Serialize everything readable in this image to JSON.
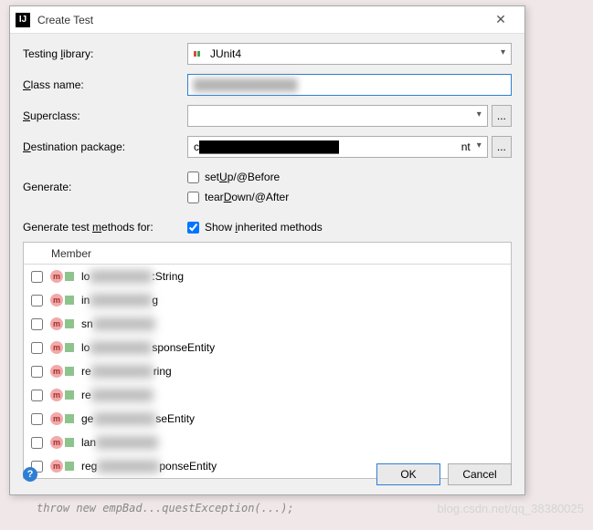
{
  "dialog": {
    "title": "Create Test",
    "labels": {
      "testing_library": "Testing library:",
      "class_name": "Class name:",
      "superclass": "Superclass:",
      "destination": "Destination package:",
      "generate": "Generate:",
      "methods_for": "Generate test methods for:"
    },
    "testing_library_value": "JUnit4",
    "class_name_value": "",
    "superclass_value": "",
    "destination_prefix": "c",
    "destination_suffix": "nt",
    "setup_label": "setUp/@Before",
    "teardown_label": "tearDown/@After",
    "show_inherited_label": "Show inherited methods",
    "show_inherited_checked": true,
    "member_header": "Member",
    "methods": [
      {
        "prefix": "lo",
        "suffix": ":String"
      },
      {
        "prefix": "in",
        "suffix": "g"
      },
      {
        "prefix": "sn",
        "suffix": ""
      },
      {
        "prefix": "lo",
        "suffix": "sponseEntity"
      },
      {
        "prefix": "re",
        "suffix": "ring"
      },
      {
        "prefix": "re",
        "suffix": ""
      },
      {
        "prefix": "ge",
        "suffix": "seEntity"
      },
      {
        "prefix": "lan",
        "suffix": ""
      },
      {
        "prefix": "reg",
        "suffix": "ponseEntity"
      }
    ],
    "ok": "OK",
    "cancel": "Cancel",
    "browse": "..."
  },
  "watermark": "blog.csdn.net/qq_38380025"
}
